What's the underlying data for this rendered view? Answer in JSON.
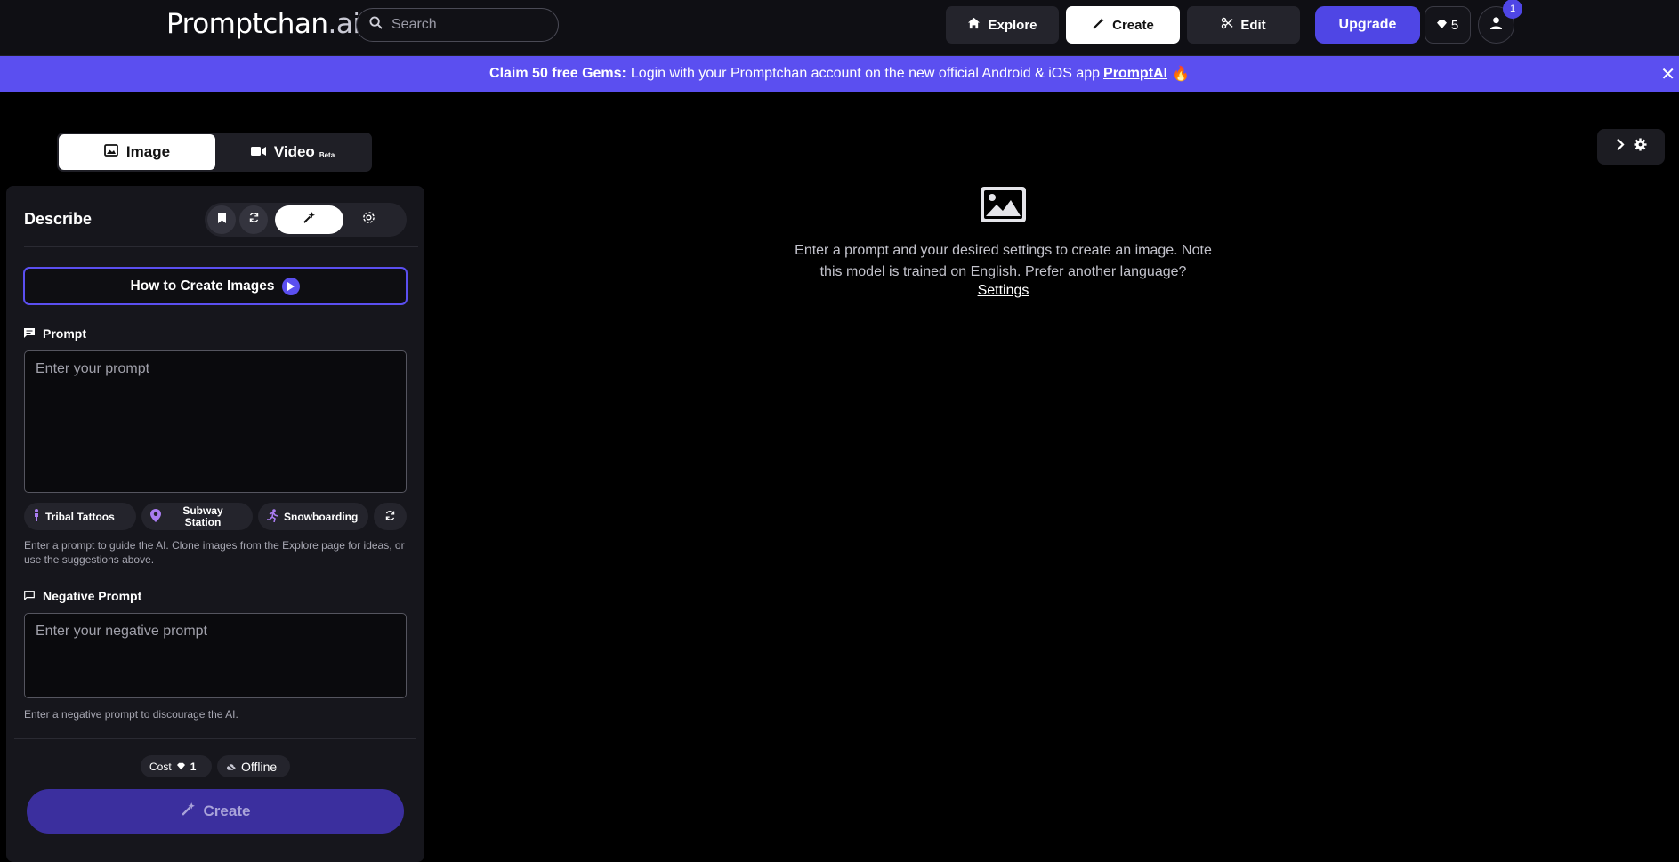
{
  "nav": {
    "logo_main": "Promptchan",
    "logo_suffix": ".ai",
    "search_placeholder": "Search",
    "explore": "Explore",
    "create": "Create",
    "edit": "Edit",
    "upgrade": "Upgrade",
    "gems": "5",
    "notifications": "1"
  },
  "banner": {
    "bold": "Claim 50 free Gems:",
    "text": "Login with your Promptchan account on the new official Android & iOS app",
    "link": "PromptAI",
    "emoji": "🔥",
    "close": "✕"
  },
  "mode_tabs": {
    "image": "Image",
    "video": "Video",
    "video_badge": "Beta"
  },
  "panel": {
    "title": "Describe",
    "howto": "How to Create Images",
    "prompt_label": "Prompt",
    "prompt_placeholder": "Enter your prompt",
    "suggestions": [
      "Tribal Tattoos",
      "Subway Station",
      "Snowboarding"
    ],
    "prompt_hint": "Enter a prompt to guide the AI. Clone images from the Explore page for ideas, or use the suggestions above.",
    "negative_label": "Negative Prompt",
    "negative_placeholder": "Enter your negative prompt",
    "negative_hint": "Enter a negative prompt to discourage the AI.",
    "cost_label": "Cost",
    "cost_value": "1",
    "status": "Offline",
    "create": "Create"
  },
  "main": {
    "empty_text": "Enter a prompt and your desired settings to create an image. Note this model is trained on English. Prefer another language?",
    "settings_link": "Settings"
  },
  "colors": {
    "accent": "#5b4ff0",
    "create_button": "#3b2f9e"
  },
  "icons": [
    "search-icon",
    "home-icon",
    "wand-icon",
    "scissors-icon",
    "gem-icon",
    "user-icon",
    "image-icon",
    "video-icon",
    "bookmark-icon",
    "refresh-icon",
    "sparkle-icon",
    "gear-icon",
    "play-icon",
    "message-icon",
    "person-icon",
    "pin-icon",
    "runner-icon",
    "cloud-off-icon",
    "chevron-right-icon",
    "picture-placeholder-icon"
  ]
}
